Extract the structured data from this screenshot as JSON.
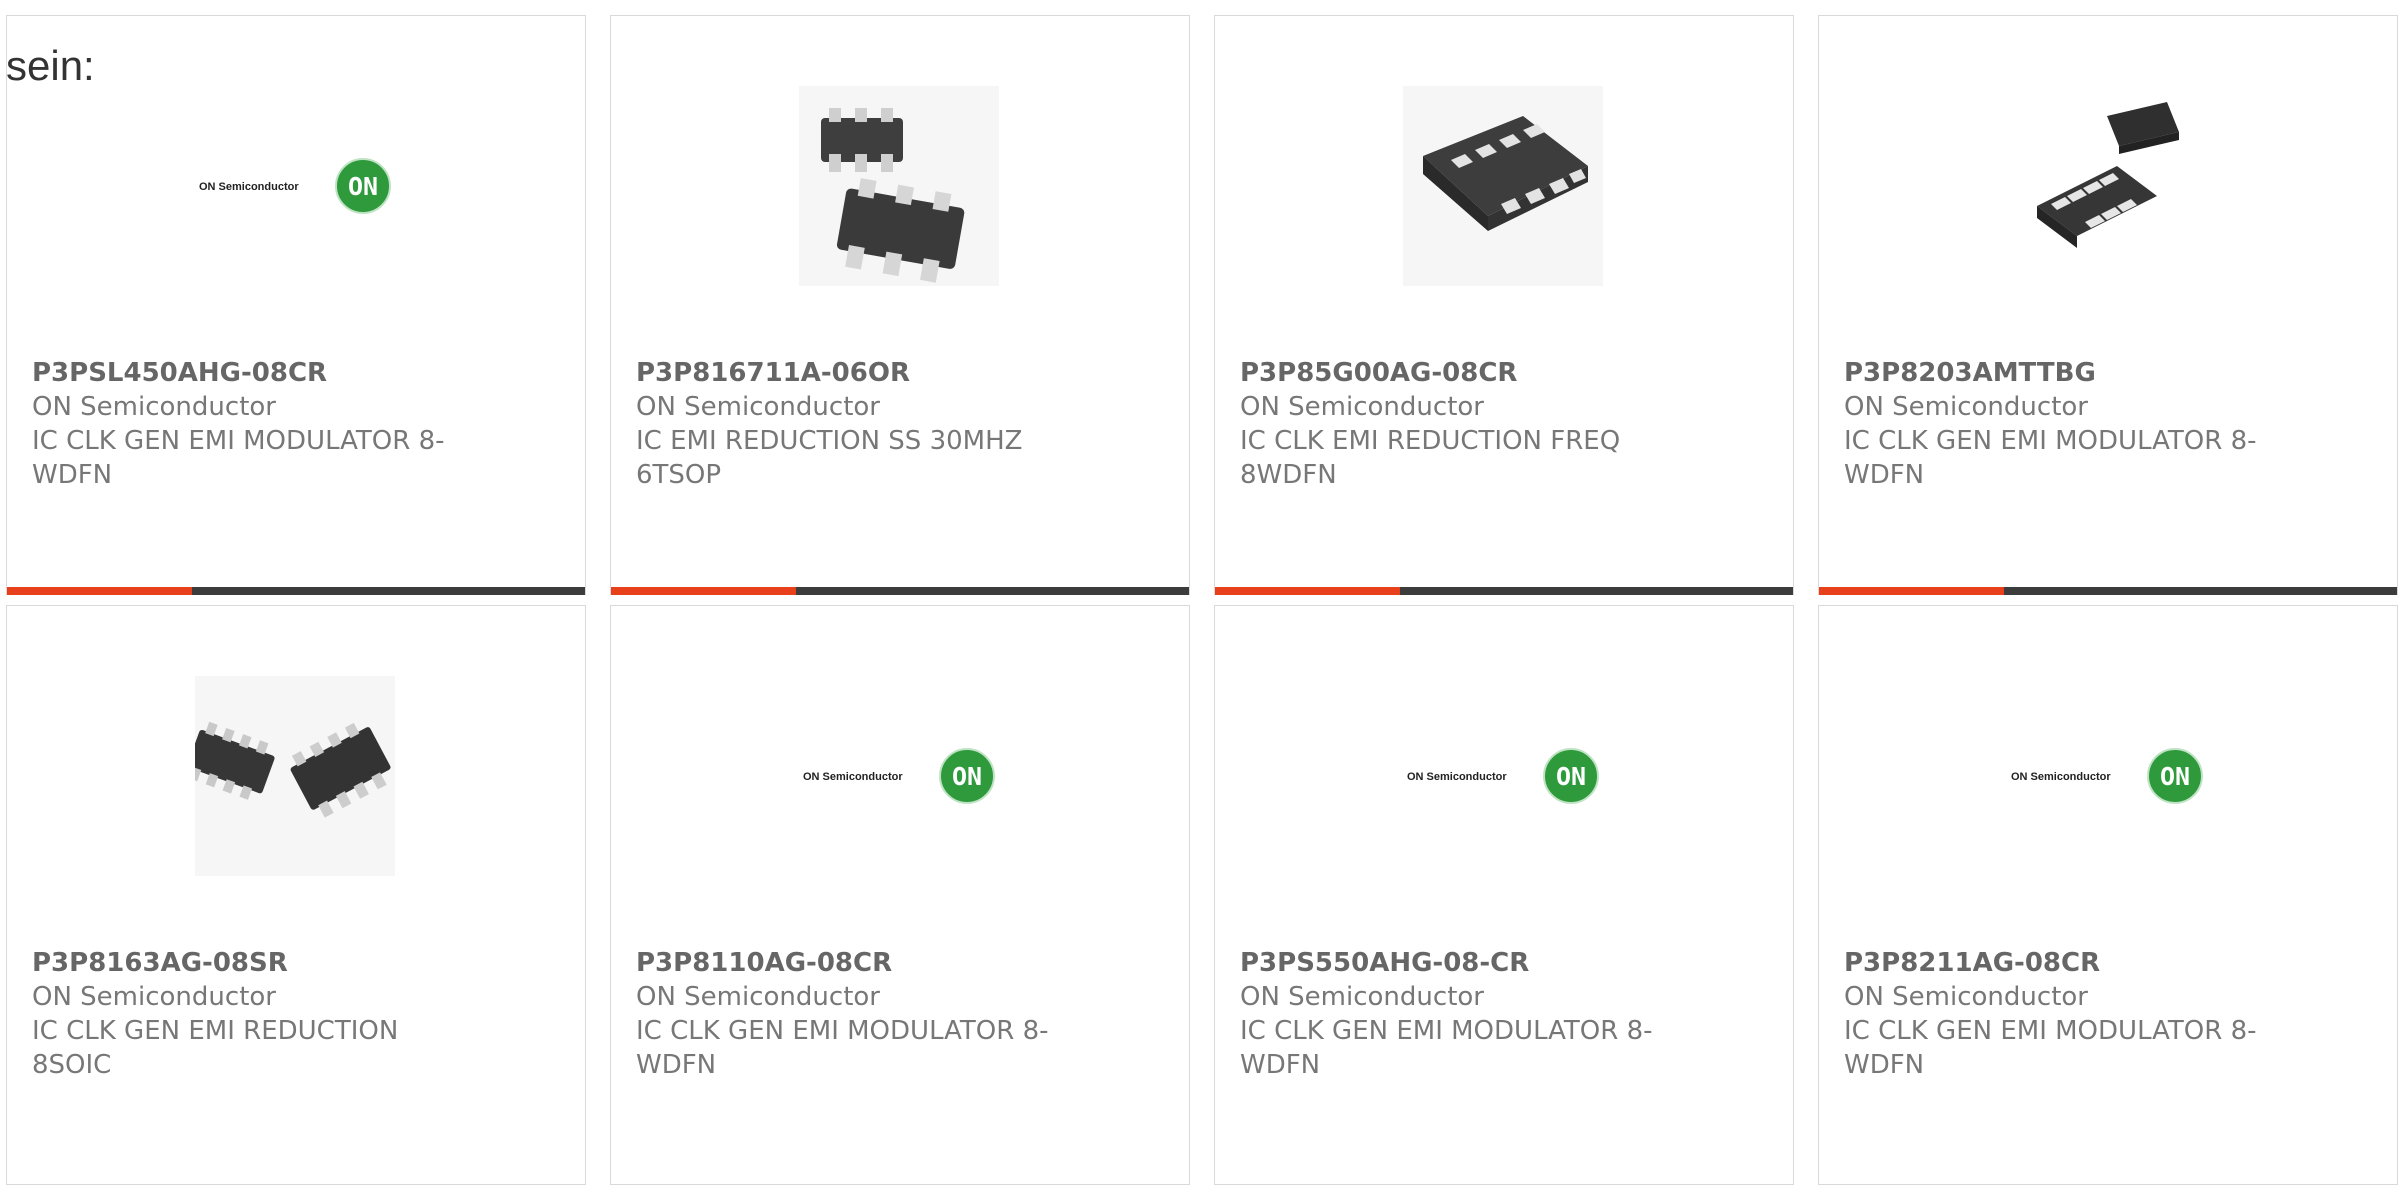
{
  "intro_text": "sein:",
  "colors": {
    "accent": "#e7401a",
    "bar_dark": "#3c3c3c",
    "on_green": "#2e9a3c"
  },
  "cards": [
    {
      "part_number": "P3PSL450AHG-08CR",
      "manufacturer": "ON Semiconductor",
      "description": "IC CLK GEN EMI MODULATOR 8-WDFN",
      "image": "on-semi-logo",
      "logo_text": "ON Semiconductor",
      "logo_badge": "ON",
      "progress": 0.32
    },
    {
      "part_number": "P3P816711A-06OR",
      "manufacturer": "ON Semiconductor",
      "description": "IC EMI REDUCTION SS 30MHZ 6TSOP",
      "image": "tsop6-chip",
      "progress": 0.32
    },
    {
      "part_number": "P3P85G00AG-08CR",
      "manufacturer": "ON Semiconductor",
      "description": "IC CLK EMI REDUCTION FREQ 8WDFN",
      "image": "wdfn8-chip",
      "progress": 0.32
    },
    {
      "part_number": "P3P8203AMTTBG",
      "manufacturer": "ON Semiconductor",
      "description": "IC CLK GEN EMI MODULATOR 8-WDFN",
      "image": "wdfn8-pair-chip",
      "progress": 0.32
    },
    {
      "part_number": "P3P8163AG-08SR",
      "manufacturer": "ON Semiconductor",
      "description": "IC CLK GEN EMI REDUCTION 8SOIC",
      "image": "soic8-chip"
    },
    {
      "part_number": "P3P8110AG-08CR",
      "manufacturer": "ON Semiconductor",
      "description": "IC CLK GEN EMI MODULATOR 8-WDFN",
      "image": "on-semi-logo",
      "logo_text": "ON Semiconductor",
      "logo_badge": "ON"
    },
    {
      "part_number": "P3PS550AHG-08-CR",
      "manufacturer": "ON Semiconductor",
      "description": "IC CLK GEN EMI MODULATOR 8-WDFN",
      "image": "on-semi-logo",
      "logo_text": "ON Semiconductor",
      "logo_badge": "ON"
    },
    {
      "part_number": "P3P8211AG-08CR",
      "manufacturer": "ON Semiconductor",
      "description": "IC CLK GEN EMI MODULATOR 8-WDFN",
      "image": "on-semi-logo",
      "logo_text": "ON Semiconductor",
      "logo_badge": "ON"
    }
  ]
}
